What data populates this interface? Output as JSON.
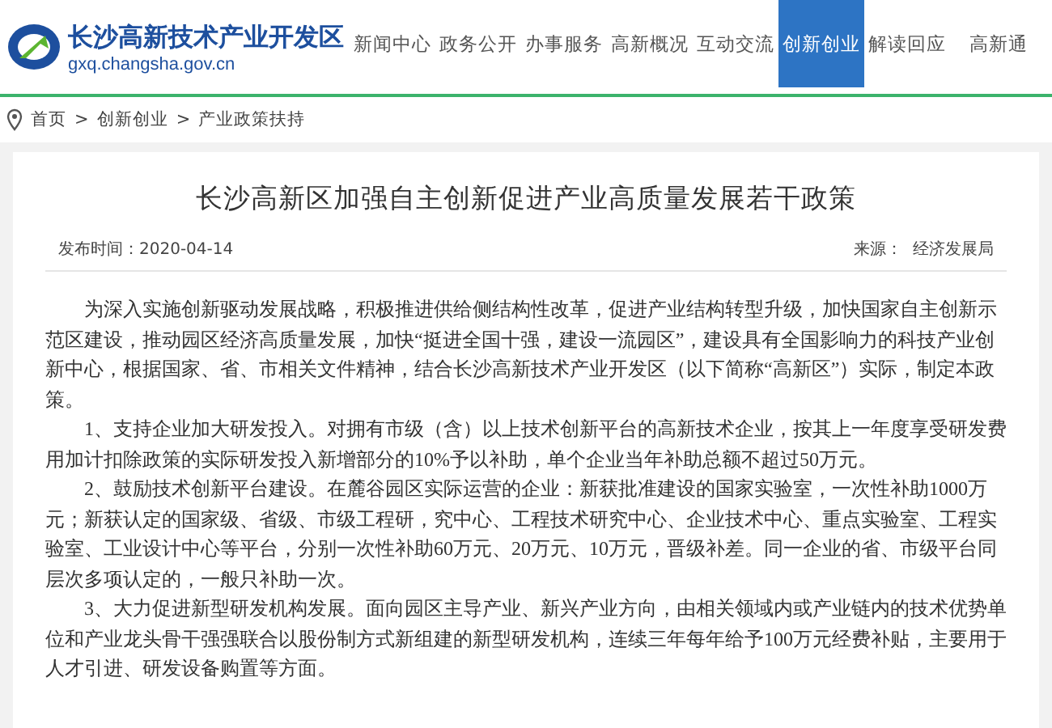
{
  "site": {
    "name": "长沙高新技术产业开发区",
    "domain": "gxq.changsha.gov.cn"
  },
  "nav": [
    {
      "label": "新闻中心",
      "selected": false
    },
    {
      "label": "政务公开",
      "selected": false
    },
    {
      "label": "办事服务",
      "selected": false
    },
    {
      "label": "高新概况",
      "selected": false
    },
    {
      "label": "互动交流",
      "selected": false
    },
    {
      "label": "创新创业",
      "selected": true
    },
    {
      "label": "解读回应",
      "selected": false
    },
    {
      "label": "高新通",
      "selected": false
    }
  ],
  "breadcrumb": [
    "首页",
    "创新创业",
    "产业政策扶持"
  ],
  "breadcrumb_separator": ">",
  "article": {
    "title": "长沙高新区加强自主创新促进产业高质量发展若干政策",
    "published": "发布时间：2020-04-14",
    "source": "来源：  经济发展局",
    "paragraphs": [
      "为深入实施创新驱动发展战略，积极推进供给侧结构性改革，促进产业结构转型升级，加快国家自主创新示范区建设，推动园区经济高质量发展，加快“挺进全国十强，建设一流园区”，建设具有全国影响力的科技产业创新中心，根据国家、省、市相关文件精神，结合长沙高新技术产业开发区（以下简称“高新区”）实际，制定本政策。",
      "1、支持企业加大研发投入。对拥有市级（含）以上技术创新平台的高新技术企业，按其上一年度享受研发费用加计扣除政策的实际研发投入新增部分的10%予以补助，单个企业当年补助总额不超过50万元。",
      "2、鼓励技术创新平台建设。在麓谷园区实际运营的企业：新获批准建设的国家实验室，一次性补助1000万元；新获认定的国家级、省级、市级工程研，究中心、工程技术研究中心、企业技术中心、重点实验室、工程实验室、工业设计中心等平台，分别一次性补助60万元、20万元、10万元，晋级补差。同一企业的省、市级平台同层次多项认定的，一般只补助一次。",
      "3、大力促进新型研发机构发展。面向园区主导产业、新兴产业方向，由相关领域内或产业链内的技术优势单位和产业龙头骨干强强联合以股份制方式新组建的新型研发机构，连续三年每年给予100万元经费补贴，主要用于人才引进、研发设备购置等方面。"
    ]
  }
}
